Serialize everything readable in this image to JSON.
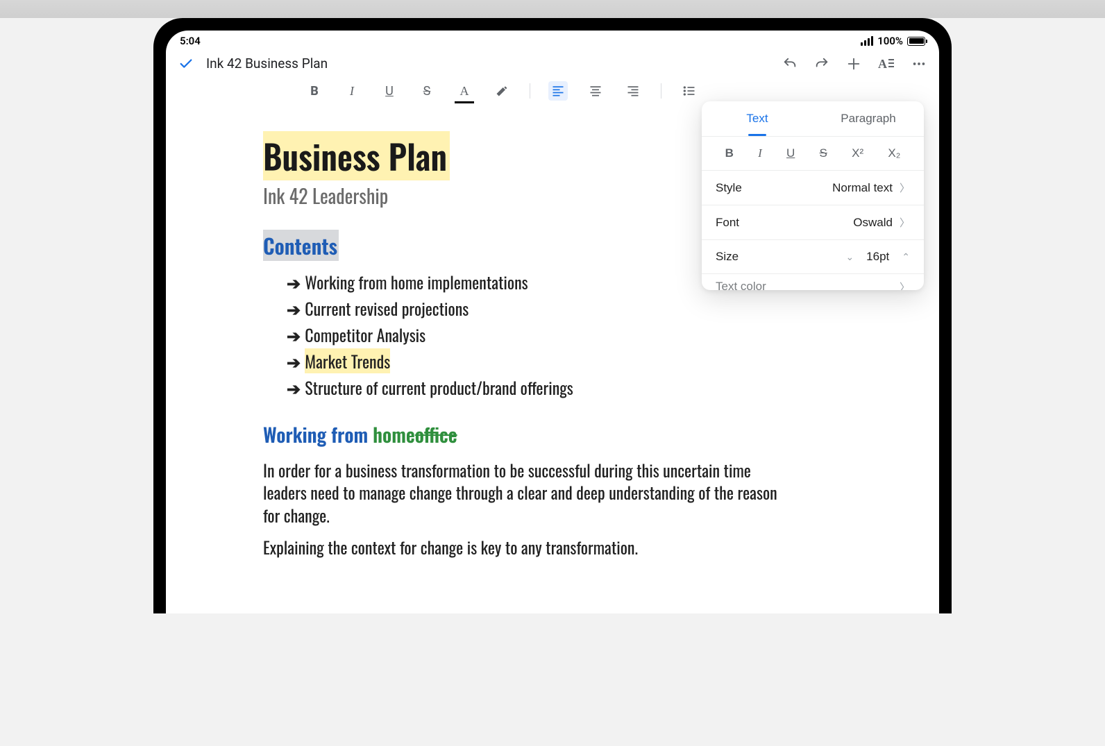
{
  "status": {
    "time": "5:04",
    "battery_pct": "100%"
  },
  "header": {
    "title": "Ink 42 Business Plan"
  },
  "toolbar": {
    "bold": "B",
    "italic": "I",
    "underline": "U",
    "strike": "S",
    "textcolor": "A"
  },
  "panel": {
    "tabs": {
      "text": "Text",
      "paragraph": "Paragraph"
    },
    "style_buttons": {
      "bold": "B",
      "italic": "I",
      "underline": "U",
      "strike": "S",
      "sup": "X²",
      "sub": "X₂"
    },
    "rows": {
      "style_label": "Style",
      "style_value": "Normal text",
      "font_label": "Font",
      "font_value": "Oswald",
      "size_label": "Size",
      "size_value": "16pt",
      "textcolor_label": "Text color",
      "textcolor_value_hex": "#1a58c6"
    }
  },
  "doc": {
    "h1": "Business Plan",
    "subtitle": "Ink 42 Leadership",
    "h2_contents": "Contents",
    "items": [
      "Working from home implementations",
      "Current revised projections",
      "Competitor Analysis",
      "Market Trends",
      "Structure of current product/brand offerings"
    ],
    "h3_prefix": "Working from ",
    "h3_green": "home",
    "h3_strike": "office",
    "p1": "In order for a business transformation to be successful during this uncertain time leaders need to manage change through a clear and deep understanding of the reason for change.",
    "p2": "Explaining the context for change is key to any transformation."
  }
}
